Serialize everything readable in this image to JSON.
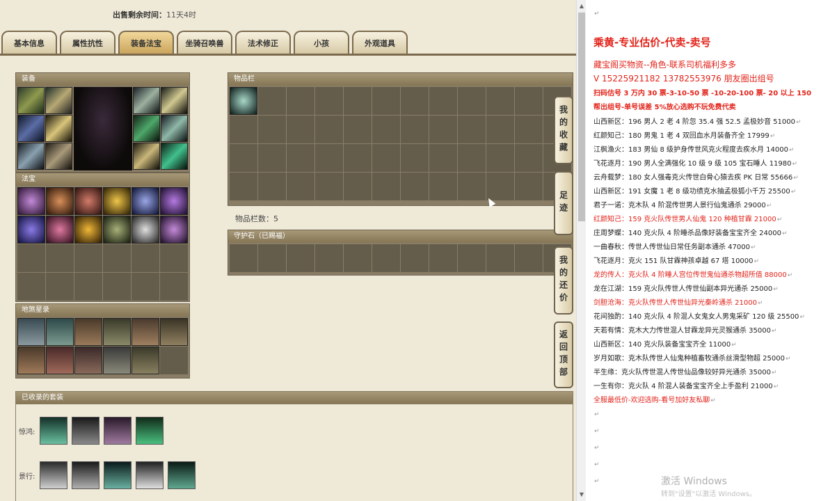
{
  "sale_time": {
    "label": "出售剩余时间：",
    "value": "11天4时"
  },
  "tabs": [
    {
      "label": "基本信息",
      "active": false
    },
    {
      "label": "属性抗性",
      "active": false
    },
    {
      "label": "装备法宝",
      "active": true
    },
    {
      "label": "坐骑召唤兽",
      "active": false
    },
    {
      "label": "法术修正",
      "active": false
    },
    {
      "label": "小孩",
      "active": false
    },
    {
      "label": "外观道具",
      "active": false
    }
  ],
  "panels": {
    "equipment": "装备",
    "magic": "法宝",
    "tianjiang": "地煞星录",
    "inventory": "物品栏",
    "guard_stone": "守护石（已赐福）"
  },
  "inventory_count": "物品栏数：5",
  "side_tabs": [
    "我的收藏",
    "足迹",
    "我的还价",
    "返回顶部"
  ],
  "suit": {
    "title": "已收录的套装",
    "rows": [
      {
        "label": "惊鸿:",
        "count": 4
      },
      {
        "label": "景行:",
        "count": 5
      }
    ]
  },
  "doc": {
    "head": "乘黄-专业估价-代卖-卖号",
    "sub1": "藏宝阁买物资--角色-联系司机福利多多",
    "sub2": "V 15225921182    13782553976 朋友圈出组号",
    "bold1": "扫码估号 3 万内 30 票-3-10-50 票  -10-20-100 票- 20 以上 150",
    "bold2": "帮出组号-单号误差 5%放心选购不玩免费代卖",
    "lines": [
      {
        "text": "山西新区：196 男人 2 老 4 阶忽 35.4 强 52.5 孟极妙音 51000",
        "red": false
      },
      {
        "text": "红颜知己：180 男鬼 1 老 4 双回血水月装备齐全 17999",
        "red": false
      },
      {
        "text": "江枫渔火：183 男仙 8 级护身传世风克火程度去疾水月 14000",
        "red": false
      },
      {
        "text": "飞花逐月：190 男人全满强化 10 级 9 级 105 宝石睡人 11980",
        "red": false
      },
      {
        "text": "云舟载梦：180 女人强毒克火传世白骨心猿去疾 PK 日常 55666",
        "red": false
      },
      {
        "text": "山西新区：191 女魔 1 老 8 级功绩克水抽孟极狐小千万 25500",
        "red": false
      },
      {
        "text": "君子一诺：克木队 4 阶混传世男人景行仙鬼通杀 29000",
        "red": false
      },
      {
        "text": "红颜知己：159 克火队传世男人仙鬼 120 种植甘霖 21000",
        "red": true
      },
      {
        "text": "庄周梦蝶：140 克火队 4 阶睡杀品像好装备宝宝齐全 24000",
        "red": false
      },
      {
        "text": "一曲春秋：传世人传世仙日常任务副本通杀 47000",
        "red": false
      },
      {
        "text": "飞花逐月：克火 151 队甘霖神孩卓越 67 塔 10000",
        "red": false
      },
      {
        "text": "龙的传人：克火队 4 阶睡人宫位传世鬼仙通杀物超所值 88000",
        "red": true
      },
      {
        "text": "龙在江湖：159 克火队传世人传世仙副本异光通杀 25000",
        "red": false
      },
      {
        "text": "剑胆沧海：克火队传世人传世仙异光秦岭通杀 21000",
        "red": true
      },
      {
        "text": "花间独酌：140 克火队 4 阶混人女鬼女人男鬼采矿 120 级 25500",
        "red": false
      },
      {
        "text": "天若有情：克木大力传世混人甘霖龙异光灵猴通杀 35000",
        "red": false
      },
      {
        "text": "山西新区：140 克火队装备宝宝齐全 11000",
        "red": false
      },
      {
        "text": "岁月如歌：克木队传世人仙鬼种植畜牧通杀丝滑型物超 25000",
        "red": false
      },
      {
        "text": "半生缘：克火队传世混人传世仙品像较好异光通杀 35000",
        "red": false
      },
      {
        "text": "一生有你：克火队 4 阶混人装备宝宝齐全上手盈利 21000",
        "red": false
      },
      {
        "text": "全服最低价-欢迎选购-看号加好友私聊",
        "red": true
      }
    ],
    "activate": "激活 Windows",
    "activate_sub": "转到\"设置\"以激活 Windows。"
  },
  "colors": {
    "accent_red": "#e2231a",
    "panel_bg": "#efe9d8",
    "slot_bg": "#645d4c"
  }
}
